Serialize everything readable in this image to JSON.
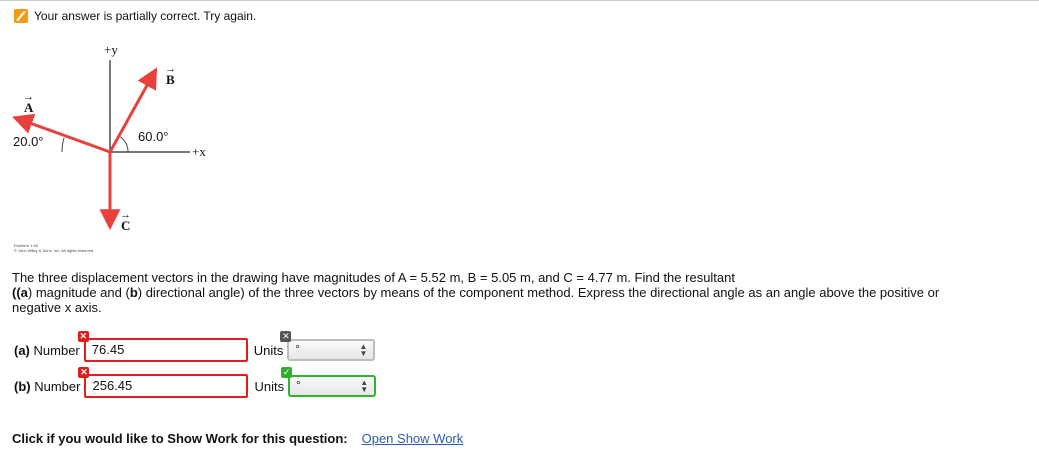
{
  "status": {
    "message": "Your answer is partially correct.  Try again.",
    "icon": "pencil-icon",
    "icon_color": "#f39c12"
  },
  "figure": {
    "axis_y_label": "+y",
    "axis_x_label": "+x",
    "vector_a": "A",
    "vector_b": "B",
    "vector_c": "C",
    "vector_arrow": "→",
    "angle_a": "20.0°",
    "angle_b": "60.0°",
    "vector_color": "#e8403d",
    "credit_line1": "Problem 1.46",
    "credit_line2": "© John Wiley & Sons, Inc. All rights reserved."
  },
  "question": {
    "text1": "The three displacement vectors in the drawing have magnitudes of A = 5.52 m, B = 5.05 m, and C = 4.77 m. Find the resultant",
    "text2a": "((",
    "text2b": "a",
    "text2c": ") magnitude and (",
    "text2d": "b",
    "text2e": ") directional angle) of the three vectors by means of the component method. Express the directional angle as an angle above the positive or",
    "text3": "negative x axis."
  },
  "part_a": {
    "prefix": "(a)",
    "label": "Number",
    "value": "76.45",
    "units_label": "Units",
    "units_value": "°",
    "status": "incorrect",
    "units_status": "unanswered"
  },
  "part_b": {
    "prefix": "(b)",
    "label": "Number",
    "value": "256.45",
    "units_label": "Units",
    "units_value": "°",
    "status": "incorrect",
    "units_status": "correct"
  },
  "show_work": {
    "label": "Click if you would like to Show Work for this question:",
    "link": "Open Show Work"
  }
}
